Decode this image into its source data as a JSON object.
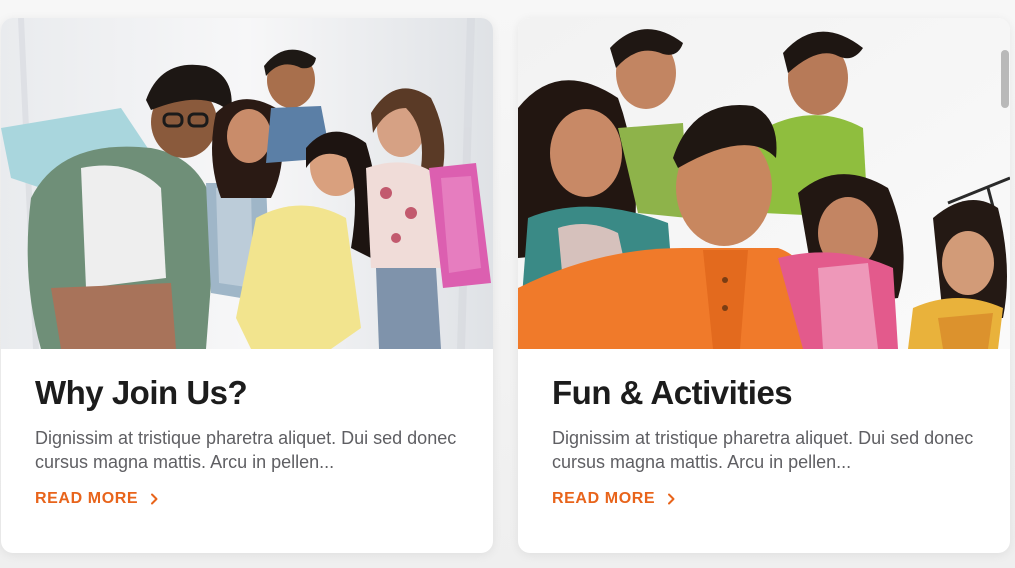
{
  "cards": [
    {
      "title": "Why Join Us?",
      "description": "Dignissim at tristique pharetra aliquet. Dui sed donec cursus magna mattis. Arcu in pellen...",
      "link_label": "READ MORE",
      "image_alt": "group-of-friends-photo"
    },
    {
      "title": "Fun & Activities",
      "description": "Dignissim at tristique pharetra aliquet. Dui sed donec cursus magna mattis. Arcu in pellen...",
      "link_label": "READ MORE",
      "image_alt": "friends-selfie-photo"
    }
  ],
  "colors": {
    "accent": "#e8641b",
    "title": "#1c1c1c",
    "body_text": "#5f5f63",
    "card_bg": "#ffffff"
  },
  "icons": {
    "link_icon": "chevron-right-icon"
  }
}
